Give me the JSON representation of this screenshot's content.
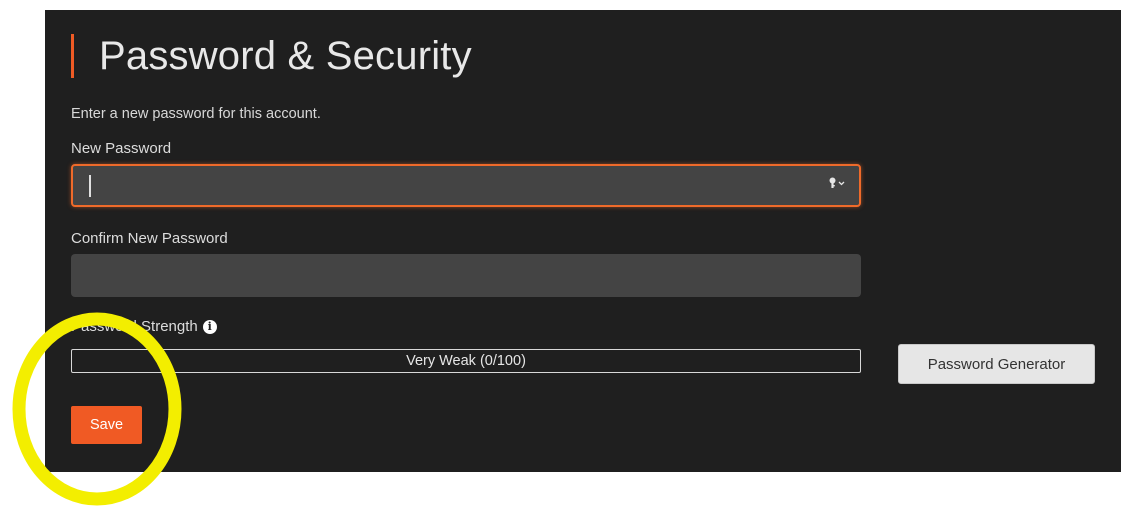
{
  "page": {
    "title": "Password & Security",
    "intro": "Enter a new password for this account."
  },
  "form": {
    "new_password": {
      "label": "New Password",
      "value": "",
      "placeholder": ""
    },
    "confirm_password": {
      "label": "Confirm New Password",
      "value": "",
      "placeholder": ""
    },
    "strength": {
      "label": "Password Strength",
      "text": "Very Weak (0/100)",
      "score": 0,
      "max": 100
    },
    "generator_button_label": "Password Generator",
    "save_button_label": "Save"
  },
  "icons": {
    "key_dropdown": "key-icon",
    "info": "info-icon"
  },
  "colors": {
    "accent": "#ef5b25",
    "background": "#1f1f1f",
    "input_background": "#444444",
    "highlight_annotation": "#f3ee00"
  }
}
